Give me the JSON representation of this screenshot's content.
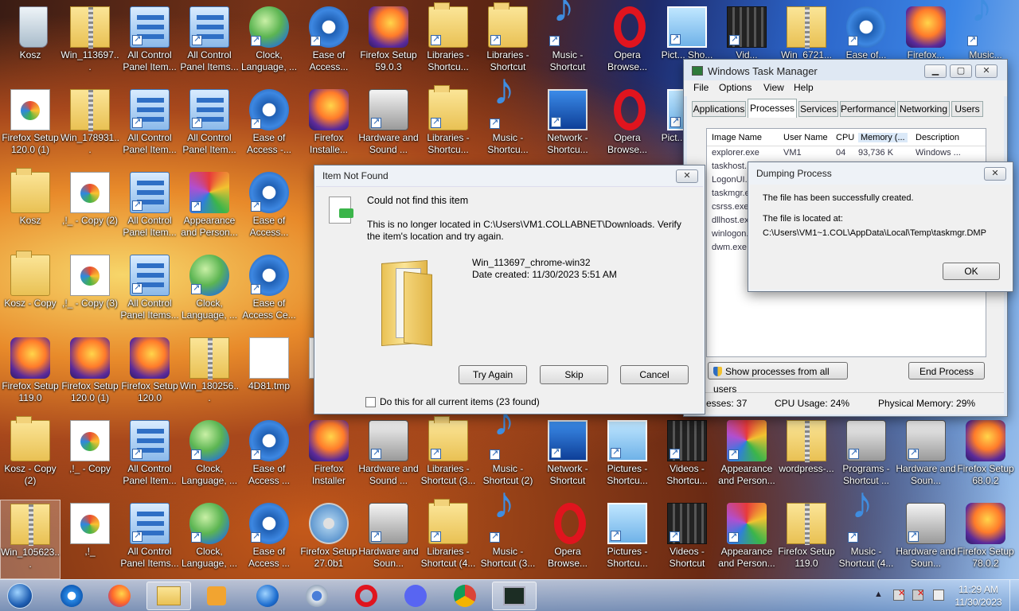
{
  "desktop": {
    "icons": [
      {
        "label": "Kosz",
        "icon": "recycle-bin-icon"
      },
      {
        "label": "Win_113697...",
        "icon": "zip-folder-icon"
      },
      {
        "label": "All Control Panel Item...",
        "icon": "control-panel-icon"
      },
      {
        "label": "All Control Panel Items...",
        "icon": "control-panel-icon"
      },
      {
        "label": "Clock, Language, ...",
        "icon": "globe-clock-icon"
      },
      {
        "label": "Ease of Access...",
        "icon": "ease-of-access-icon"
      },
      {
        "label": "Firefox Setup 59.0.3",
        "icon": "firefox-installer-icon"
      },
      {
        "label": "Libraries - Shortcu...",
        "icon": "libraries-icon"
      },
      {
        "label": "Libraries - Shortcut",
        "icon": "libraries-icon"
      },
      {
        "label": "Music - Shortcut",
        "icon": "music-icon"
      },
      {
        "label": "Opera Browse...",
        "icon": "opera-icon"
      },
      {
        "label": "Pict... Sho...",
        "icon": "pictures-icon"
      },
      {
        "label": "Vid...",
        "icon": "videos-icon"
      },
      {
        "label": "Win_6721...",
        "icon": "zip-folder-icon"
      },
      {
        "label": "Ease of...",
        "icon": "ease-of-access-icon"
      },
      {
        "label": "Firefox...",
        "icon": "firefox-installer-icon"
      },
      {
        "label": "Music...",
        "icon": "music-icon"
      },
      {
        "label": "Firefox Setup 120.0 (1)",
        "icon": "document-icon"
      },
      {
        "label": "Win_178931...",
        "icon": "zip-folder-icon"
      },
      {
        "label": "All Control Panel Item...",
        "icon": "control-panel-icon"
      },
      {
        "label": "All Control Panel Item...",
        "icon": "control-panel-icon"
      },
      {
        "label": "Ease of Access -...",
        "icon": "ease-of-access-icon"
      },
      {
        "label": "Firefox Installe...",
        "icon": "firefox-installer-icon"
      },
      {
        "label": "Hardware and Sound ...",
        "icon": "hardware-sound-icon"
      },
      {
        "label": "Libraries - Shortcu...",
        "icon": "libraries-icon"
      },
      {
        "label": "Music - Shortcu...",
        "icon": "music-icon"
      },
      {
        "label": "Network - Shortcu...",
        "icon": "network-icon"
      },
      {
        "label": "Opera Browse...",
        "icon": "opera-icon"
      },
      {
        "label": "Pict... Sho...",
        "icon": "pictures-icon"
      },
      {
        "label": "Kosz",
        "icon": "folder-icon"
      },
      {
        "label": ",!_ - Copy (2)",
        "icon": "document-icon"
      },
      {
        "label": "All Control Panel Item...",
        "icon": "control-panel-icon"
      },
      {
        "label": "Appearance and Person...",
        "icon": "appearance-icon"
      },
      {
        "label": "Ease of Access...",
        "icon": "ease-of-access-icon"
      },
      {
        "label": "Kosz - Copy",
        "icon": "folder-icon"
      },
      {
        "label": ",!_ - Copy (3)",
        "icon": "document-icon"
      },
      {
        "label": "All Control Panel Items...",
        "icon": "control-panel-icon"
      },
      {
        "label": "Clock, Language, ...",
        "icon": "globe-clock-icon"
      },
      {
        "label": "Ease of Access Ce...",
        "icon": "ease-of-access-icon"
      },
      {
        "label": "Firefox Setup 119.0",
        "icon": "firefox-installer-icon"
      },
      {
        "label": "Firefox Setup 120.0 (1)",
        "icon": "firefox-installer-icon"
      },
      {
        "label": "Firefox Setup 120.0",
        "icon": "firefox-installer-icon"
      },
      {
        "label": "Win_180256...",
        "icon": "zip-folder-icon"
      },
      {
        "label": "4D81.tmp",
        "icon": "blank-file-icon"
      },
      {
        "label": "6",
        "icon": "blank-file-icon"
      },
      {
        "label": "Kosz - Copy (2)",
        "icon": "folder-icon"
      },
      {
        "label": ",!_ - Copy",
        "icon": "document-icon"
      },
      {
        "label": "All Control Panel Item...",
        "icon": "control-panel-icon"
      },
      {
        "label": "Clock, Language, ...",
        "icon": "globe-clock-icon"
      },
      {
        "label": "Ease of Access ...",
        "icon": "ease-of-access-icon"
      },
      {
        "label": "Firefox Installer",
        "icon": "firefox-installer-icon"
      },
      {
        "label": "Hardware and Sound ...",
        "icon": "hardware-sound-icon"
      },
      {
        "label": "Libraries - Shortcut (3...",
        "icon": "libraries-icon"
      },
      {
        "label": "Music - Shortcut (2)",
        "icon": "music-icon"
      },
      {
        "label": "Network - Shortcut",
        "icon": "network-icon"
      },
      {
        "label": "Pictures - Shortcu...",
        "icon": "pictures-icon"
      },
      {
        "label": "Videos - Shortcu...",
        "icon": "videos-icon"
      },
      {
        "label": "Appearance and Person...",
        "icon": "appearance-icon"
      },
      {
        "label": "wordpress-...",
        "icon": "zip-folder-icon"
      },
      {
        "label": "Programs - Shortcut ...",
        "icon": "programs-icon"
      },
      {
        "label": "Hardware and Soun...",
        "icon": "hardware-sound-icon"
      },
      {
        "label": "Firefox Setup 68.0.2",
        "icon": "firefox-installer-icon"
      },
      {
        "label": "Win_105623...",
        "icon": "zip-folder-icon"
      },
      {
        "label": ",!_",
        "icon": "document-icon"
      },
      {
        "label": "All Control Panel Items...",
        "icon": "control-panel-icon"
      },
      {
        "label": "Clock, Language, ...",
        "icon": "globe-clock-icon"
      },
      {
        "label": "Ease of Access ...",
        "icon": "ease-of-access-icon"
      },
      {
        "label": "Firefox Setup 27.0b1",
        "icon": "setup-disc-icon"
      },
      {
        "label": "Hardware and Soun...",
        "icon": "hardware-sound-icon"
      },
      {
        "label": "Libraries - Shortcut (4...",
        "icon": "libraries-icon"
      },
      {
        "label": "Music - Shortcut (3...",
        "icon": "music-icon"
      },
      {
        "label": "Opera Browse...",
        "icon": "opera-icon"
      },
      {
        "label": "Pictures - Shortcu...",
        "icon": "pictures-icon"
      },
      {
        "label": "Videos - Shortcut",
        "icon": "videos-icon"
      },
      {
        "label": "Appearance and Person...",
        "icon": "appearance-icon"
      },
      {
        "label": "Firefox Setup 119.0",
        "icon": "zip-folder-icon"
      },
      {
        "label": "Music - Shortcut (4...",
        "icon": "music-icon"
      },
      {
        "label": "Hardware and Soun...",
        "icon": "hardware-sound-icon"
      },
      {
        "label": "Firefox Setup 78.0.2",
        "icon": "firefox-installer-icon"
      }
    ]
  },
  "task_manager": {
    "title": "Windows Task Manager",
    "menu": [
      "File",
      "Options",
      "View",
      "Help"
    ],
    "tabs": [
      "Applications",
      "Processes",
      "Services",
      "Performance",
      "Networking",
      "Users"
    ],
    "active_tab": "Processes",
    "columns": [
      "Image Name",
      "User Name",
      "CPU",
      "Memory (...",
      "Description"
    ],
    "rows": [
      [
        "explorer.exe",
        "VM1",
        "04",
        "93,736 K",
        "Windows ..."
      ],
      [
        "taskhost.",
        "",
        "",
        "",
        ""
      ],
      [
        "LogonUI.",
        "",
        "",
        "",
        ""
      ],
      [
        "taskmgr.e",
        "",
        "",
        "",
        ""
      ],
      [
        "csrss.exe",
        "",
        "",
        "",
        ""
      ],
      [
        "dllhost.ex",
        "",
        "",
        "",
        ""
      ],
      [
        "winlogon.",
        "",
        "",
        "",
        ""
      ],
      [
        "dwm.exe",
        "",
        "",
        "",
        ""
      ]
    ],
    "show_all_label": "Show processes from all users",
    "end_process_label": "End Process",
    "status": {
      "processes": "esses: 37",
      "cpu": "CPU Usage: 24%",
      "memory": "Physical Memory: 29%"
    }
  },
  "item_not_found": {
    "title": "Item Not Found",
    "heading": "Could not find this item",
    "message": "This is no longer located in C:\\Users\\VM1.COLLABNET\\Downloads. Verify the item's location and try again.",
    "item_name": "Win_113697_chrome-win32",
    "item_date": "Date created: 11/30/2023 5:51 AM",
    "try_again": "Try Again",
    "skip": "Skip",
    "cancel": "Cancel",
    "checkbox_label": "Do this for all current items (23 found)"
  },
  "dumping_process": {
    "title": "Dumping Process",
    "line1": "The file has been successfully created.",
    "line2": "The file is located at:",
    "path": "C:\\Users\\VM1~1.COL\\AppData\\Local\\Temp\\taskmgr.DMP",
    "ok": "OK"
  },
  "taskbar": {
    "items": [
      "start-orb-icon",
      "internet-explorer-icon",
      "firefox-icon",
      "explorer-folder-icon",
      "media-player-icon",
      "thunderbird-icon",
      "chromium-icon",
      "opera-icon",
      "discord-icon",
      "chrome-icon",
      "task-manager-icon"
    ],
    "time": "11:29 AM",
    "date": "11/30/2023"
  }
}
